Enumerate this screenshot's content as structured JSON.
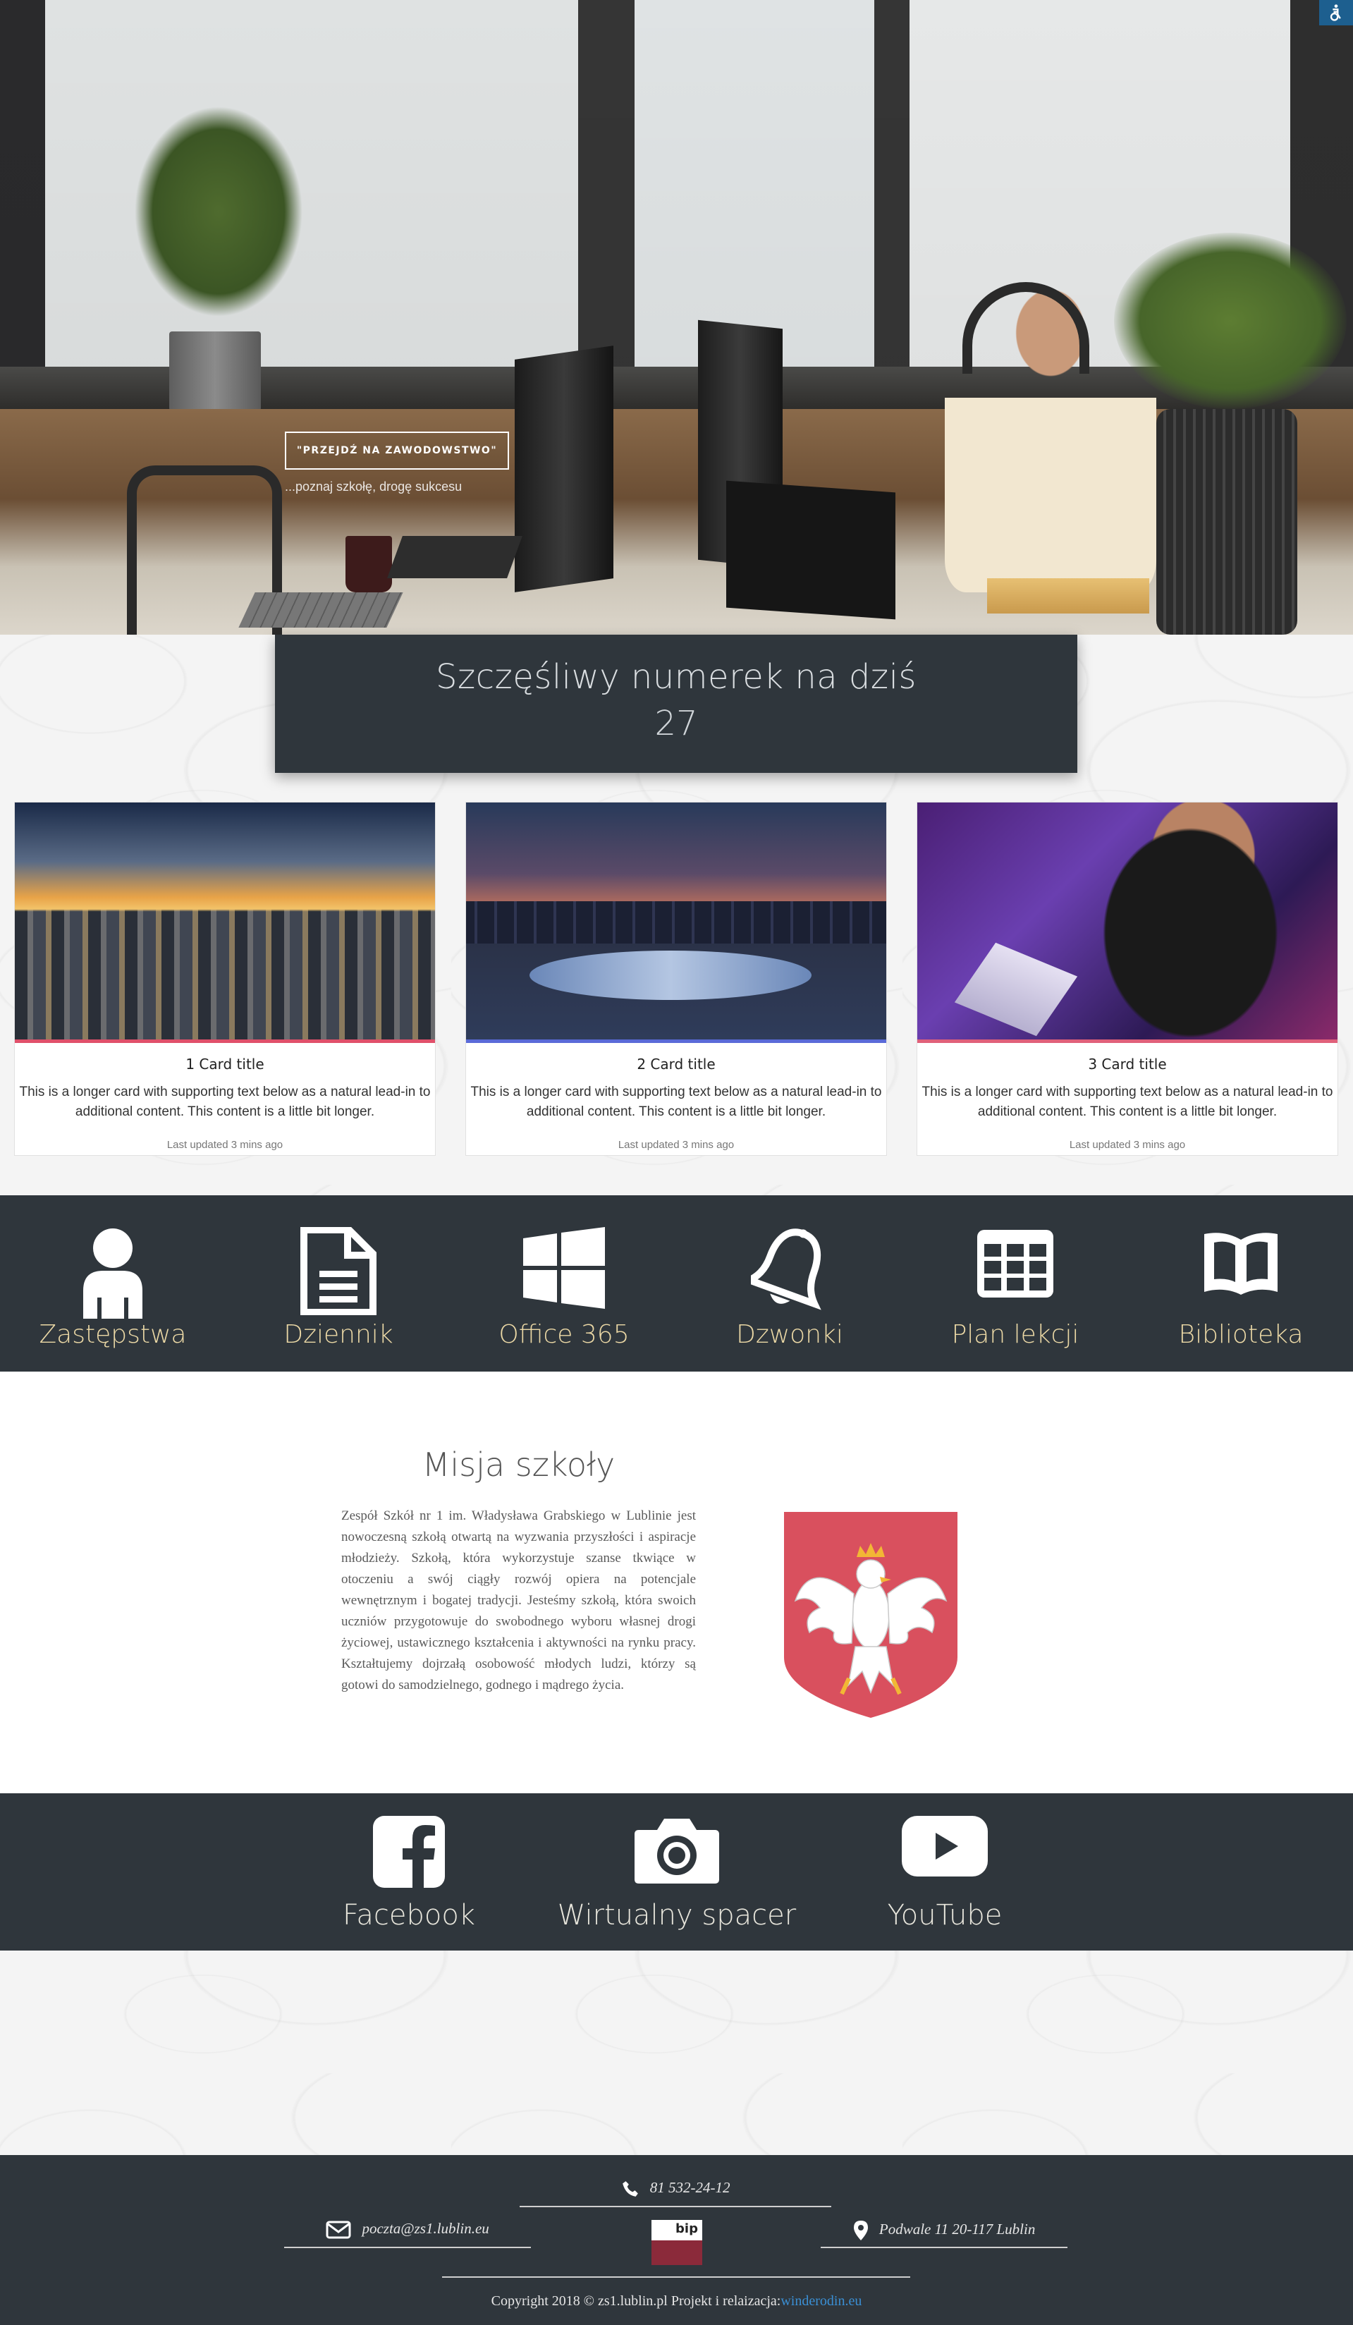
{
  "hero": {
    "cta_label": "\"PRZEJDŹ NA ZAWODOWSTWO\"",
    "cta_sub": "...poznaj szkołę, drogę sukcesu"
  },
  "accessibility": {
    "icon": "accessibility-icon"
  },
  "lucky": {
    "title": "Szczęśliwy numerek na dziś",
    "number": "27"
  },
  "cards": [
    {
      "title": "1 Card title",
      "text": "This is a longer card with supporting text below as a natural lead-in to additional content. This content is a little bit longer.",
      "footer": "Last updated 3 mins ago",
      "accent": "#e0506a"
    },
    {
      "title": "2 Card title",
      "text": "This is a longer card with supporting text below as a natural lead-in to additional content. This content is a little bit longer.",
      "footer": "Last updated 3 mins ago",
      "accent": "#5a6ad8"
    },
    {
      "title": "3 Card title",
      "text": "This is a longer card with supporting text below as a natural lead-in to additional content. This content is a little bit longer.",
      "footer": "Last updated 3 mins ago",
      "accent": "#e0607a"
    }
  ],
  "iconbar": [
    {
      "label": "Zastępstwa",
      "icon": "user-icon"
    },
    {
      "label": "Dziennik",
      "icon": "document-icon"
    },
    {
      "label": "Office 365",
      "icon": "windows-icon"
    },
    {
      "label": "Dzwonki",
      "icon": "bell-icon"
    },
    {
      "label": "Plan lekcji",
      "icon": "table-icon"
    },
    {
      "label": "Biblioteka",
      "icon": "book-icon"
    }
  ],
  "mission": {
    "title": "Misja szkoły",
    "text": "Zespół Szkół nr 1 im. Władysława Grabskiego w Lublinie jest nowoczesną szkołą otwartą na wyzwania przyszłości i aspiracje młodzieży. Szkołą, która wykorzystuje szanse tkwiące w otoczeniu a swój ciągły rozwój opiera na potencjale wewnętrznym i bogatej tradycji. Jesteśmy szkołą, która swoich uczniów przygotowuje do swobodnego wyboru własnej drogi życiowej, ustawicznego kształcenia i aktywności na rynku pracy. Kształtujemy dojrzałą osobowość młodych ludzi, którzy są gotowi do samodzielnego, godnego i mądrego życia.",
    "emblem": "polish-eagle-emblem-icon"
  },
  "social": [
    {
      "label": "Facebook",
      "icon": "facebook-icon"
    },
    {
      "label": "Wirtualny spacer",
      "icon": "camera-icon"
    },
    {
      "label": "YouTube",
      "icon": "youtube-icon"
    }
  ],
  "footer": {
    "phone": "81 532-24-12",
    "email": "poczta@zs1.lublin.eu",
    "address": "Podwale 11 20-117 Lublin",
    "bip": "bip",
    "copyright": "Copyright 2018 © zs1.lublin.pl Projekt i relaizacja:",
    "credit_link": "winderodin.eu"
  },
  "colors": {
    "dark": "#2f363c",
    "link": "#3a8fd4",
    "gold_label": "#ecd9a6"
  }
}
